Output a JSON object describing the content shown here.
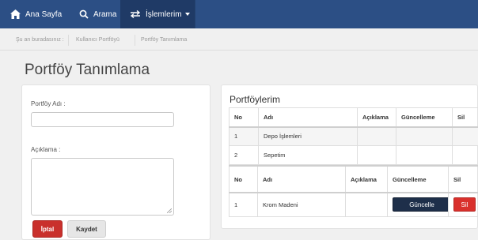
{
  "nav": {
    "home_label": "Ana Sayfa",
    "search_label": "Arama",
    "operations_label": "İşlemlerim"
  },
  "breadcrumb": {
    "prefix": "Şu an buradasınız :",
    "items": [
      "Kullanıcı Portföyü",
      "Portföy Tanımlama"
    ]
  },
  "page_title": "Portföy Tanımlama",
  "form": {
    "name_label": "Portföy Adı :",
    "name_value": "",
    "description_label": "Açıklama :",
    "description_value": "",
    "cancel_label": "İptal",
    "save_label": "Kaydet"
  },
  "portfolios": {
    "title": "Portföylerim",
    "columns": [
      "No",
      "Adı",
      "Açıklama",
      "Güncelleme",
      "Sil"
    ],
    "rows": [
      {
        "no": "1",
        "name": "Depo İşlemleri",
        "description": "",
        "update": "",
        "delete": ""
      },
      {
        "no": "2",
        "name": "Sepetim",
        "description": "",
        "update": "",
        "delete": ""
      }
    ]
  },
  "second_table": {
    "columns": [
      "No",
      "Adı",
      "Açıklama",
      "Güncelleme",
      "Sil"
    ],
    "rows": [
      {
        "no": "1",
        "name": "Krom Madeni",
        "description": "",
        "update_label": "Güncelle",
        "delete_label": "Sil"
      }
    ]
  },
  "colors": {
    "navbar": "#2c4f85",
    "navbar_active": "#1f3a66",
    "danger": "#c9302c",
    "dark_button": "#1e2f4a"
  },
  "icons": {
    "home": "home-icon",
    "search": "search-icon",
    "operations": "transfer-icon",
    "dropdown": "caret-down-icon"
  }
}
